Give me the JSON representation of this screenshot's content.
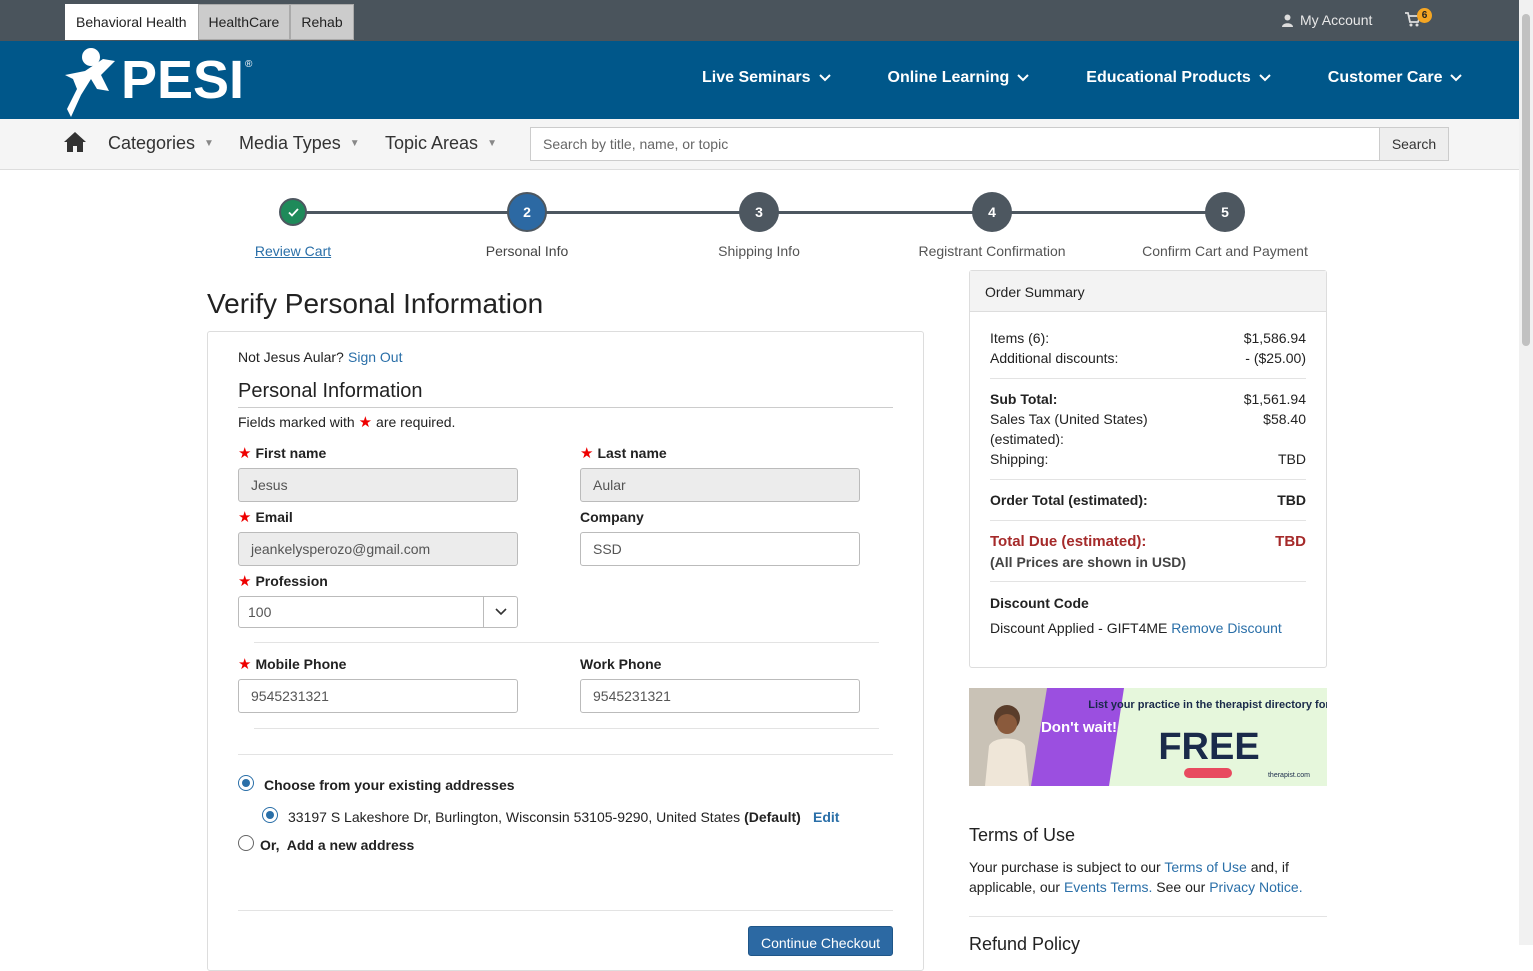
{
  "topbar": {
    "site_tabs": [
      "Behavioral Health",
      "HealthCare",
      "Rehab"
    ],
    "account_label": "My Account",
    "cart_count": "6"
  },
  "header": {
    "logo_text": "PESI",
    "nav": [
      "Live Seminars",
      "Online Learning",
      "Educational Products",
      "Customer Care"
    ]
  },
  "subnav": {
    "dropdowns": [
      "Categories",
      "Media Types",
      "Topic Areas"
    ],
    "search_placeholder": "Search by title, name, or topic",
    "search_button": "Search"
  },
  "steps": [
    {
      "number": "",
      "label": "Review Cart",
      "state": "done"
    },
    {
      "number": "2",
      "label": "Personal Info",
      "state": "current"
    },
    {
      "number": "3",
      "label": "Shipping Info",
      "state": "todo"
    },
    {
      "number": "4",
      "label": "Registrant Confirmation",
      "state": "todo"
    },
    {
      "number": "5",
      "label": "Confirm Cart and Payment",
      "state": "todo"
    }
  ],
  "form": {
    "page_title": "Verify Personal Information",
    "not_user_text": "Not Jesus Aular?",
    "sign_out": "Sign Out",
    "section_title": "Personal Information",
    "required_prefix": "Fields marked with",
    "required_suffix": "are required.",
    "first_name_label": "First name",
    "first_name_value": "Jesus",
    "last_name_label": "Last name",
    "last_name_value": "Aular",
    "email_label": "Email",
    "email_value": "jeankelysperozo@gmail.com",
    "company_label": "Company",
    "company_value": "SSD",
    "profession_label": "Profession",
    "profession_value": "100",
    "mobile_label": "Mobile Phone",
    "mobile_value": "9545231321",
    "work_label": "Work Phone",
    "work_value": "9545231321",
    "existing_addresses": "Choose from your existing addresses",
    "address": "33197 S Lakeshore Dr, Burlington, Wisconsin 53105-9290, United States",
    "address_default": "(Default)",
    "address_edit": "Edit",
    "new_address_or": "Or,",
    "new_address": "Add a new address",
    "continue_button": "Continue Checkout"
  },
  "summary": {
    "title": "Order Summary",
    "items_label": "Items (6):",
    "items_value": "$1,586.94",
    "discounts_label": "Additional discounts:",
    "discounts_value": "- ($25.00)",
    "subtotal_label": "Sub Total:",
    "subtotal_value": "$1,561.94",
    "tax_label_1": "Sales Tax (United States)",
    "tax_label_2": "(estimated):",
    "tax_value": "$58.40",
    "shipping_label": "Shipping:",
    "shipping_value": "TBD",
    "order_total_label": "Order Total (estimated):",
    "order_total_value": "TBD",
    "due_label": "Total Due (estimated):",
    "due_value": "TBD",
    "usd_note": "(All Prices are shown in USD)",
    "discount_code_label": "Discount Code",
    "discount_applied": "Discount Applied - GIFT4ME",
    "remove_discount": "Remove Discount"
  },
  "ad": {
    "dont_wait": "Don't wait!",
    "headline": "List your practice in the therapist directory for",
    "free": "FREE",
    "brand": "therapist.com"
  },
  "terms": {
    "title": "Terms of Use",
    "text_1": "Your purchase is subject to our",
    "terms_link": "Terms of Use",
    "text_2": "and, if applicable, our",
    "events_link": "Events Terms.",
    "text_3": "See our",
    "privacy_link": "Privacy Notice.",
    "refund_title": "Refund Policy"
  },
  "colors": {
    "header_blue": "#00578a",
    "topbar_gray": "#4a545c",
    "step_done": "#1e8a5a",
    "step_current": "#2c69a3",
    "step_todo": "#4d5760",
    "link": "#2a6fa8",
    "total_due": "#a52a2a"
  }
}
